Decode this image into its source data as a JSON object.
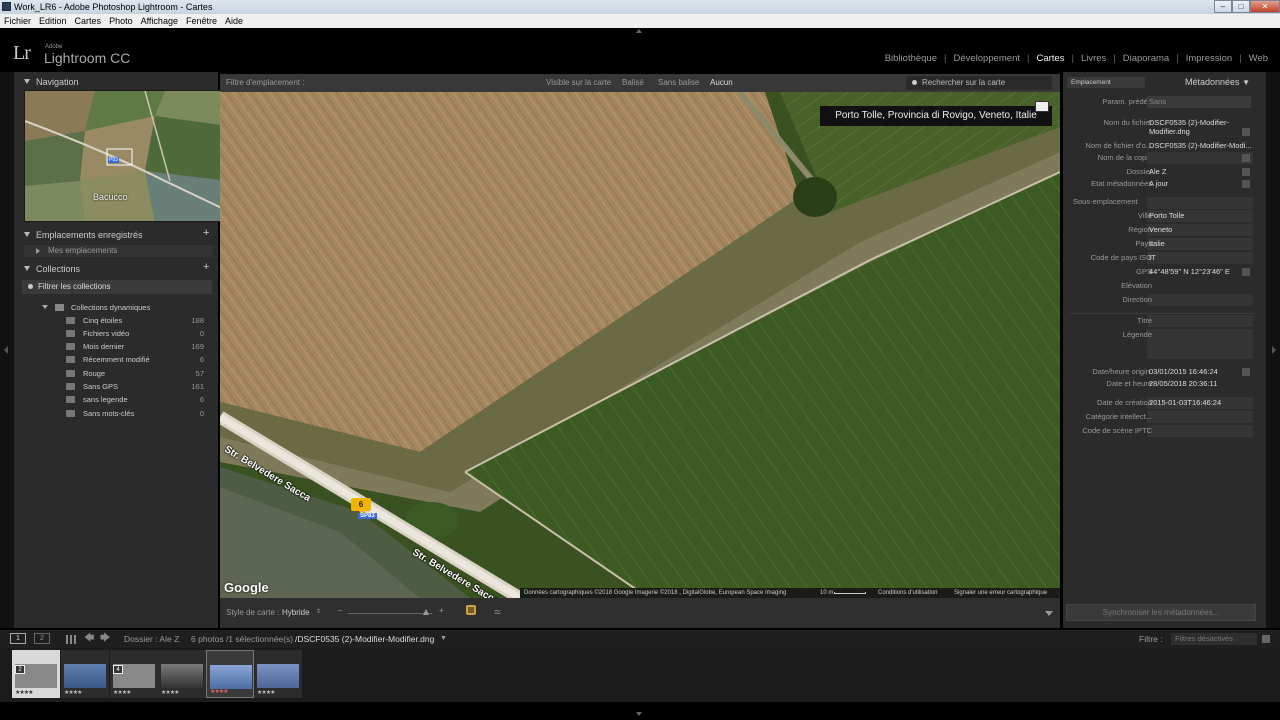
{
  "window": {
    "title": "Work_LR6 - Adobe Photoshop Lightroom - Cartes"
  },
  "menu": [
    "Fichier",
    "Edition",
    "Cartes",
    "Photo",
    "Affichage",
    "Fenêtre",
    "Aide"
  ],
  "brand": {
    "adobe": "Adobe",
    "name": "Lightroom CC",
    "logo": "Lr"
  },
  "modules": [
    "Bibliothèque",
    "Développement",
    "Cartes",
    "Livres",
    "Diaporama",
    "Impression",
    "Web"
  ],
  "active_module": "Cartes",
  "left": {
    "navigation": "Navigation",
    "nav_map_label": "Bacucco",
    "nav_pin": "P83",
    "saved_locations": "Emplacements enregistrés",
    "my_locations": "Mes emplacements",
    "collections": "Collections",
    "filter": "Filtrer les collections",
    "smart_collections": "Collections dynamiques",
    "items": [
      {
        "name": "Cinq étoiles",
        "count": "188"
      },
      {
        "name": "Fichiers vidéo",
        "count": "0"
      },
      {
        "name": "Mois dernier",
        "count": "169"
      },
      {
        "name": "Récemment modifié",
        "count": "6"
      },
      {
        "name": "Rouge",
        "count": "57"
      },
      {
        "name": "Sans GPS",
        "count": "161"
      },
      {
        "name": "sans legende",
        "count": "6"
      },
      {
        "name": "Sans mots-clés",
        "count": "0"
      }
    ]
  },
  "map_toolbar": {
    "label": "Filtre d'emplacement :",
    "filters": [
      "Visible sur la carte",
      "Balisé",
      "Sans balise",
      "Aucun"
    ],
    "active_filter": "Aucun",
    "search_placeholder": "Rechercher sur la carte"
  },
  "map": {
    "location": "Porto Tolle, Provincia di Rovigo, Veneto, Italie",
    "road1": "Str. Belvedere Sacca",
    "road2": "Str. Belvedere Sacca",
    "marker_count": "6",
    "road_badge": "SP83",
    "google": "Google",
    "attribution": "Données cartographiques ©2018 Google Imagerie ©2018 , DigitalGlobe, European Space Imaging",
    "scale": "10 m",
    "terms": "Conditions d'utilisation",
    "report": "Signaler une erreur cartographique"
  },
  "map_bottom": {
    "style_label": "Style de carte :",
    "style_value": "Hybride"
  },
  "right": {
    "preset_dropdown": "Emplacement",
    "title": "Métadonnées",
    "preset_label": "Param. prédéf.",
    "preset_value": "Sans",
    "fields": [
      {
        "label": "Nom du fichier",
        "value": "DSCF0535 (2)-Modifier-"
      },
      {
        "label": "",
        "value": "Modifier.dng"
      },
      {
        "label": "Nom de fichier d'o...",
        "value": "DSCF0535 (2)-Modifier-Modi..."
      },
      {
        "label": "Nom de la copie",
        "value": ""
      },
      {
        "label": "Dossier",
        "value": "Ale Z"
      },
      {
        "label": "Etat métadonnées",
        "value": "A jour"
      }
    ],
    "sublocation": "Sous-emplacement",
    "loc_fields": [
      {
        "label": "Ville",
        "value": "Porto Tolle"
      },
      {
        "label": "Région",
        "value": "Veneto"
      },
      {
        "label": "Pays",
        "value": "Italie"
      },
      {
        "label": "Code de pays ISO",
        "value": "IT"
      },
      {
        "label": "GPS",
        "value": "44°48'59\" N 12°23'46\" E"
      },
      {
        "label": "Elévation",
        "value": ""
      },
      {
        "label": "Direction",
        "value": ""
      }
    ],
    "title_label": "Titre",
    "caption_label": "Légende",
    "date_fields": [
      {
        "label": "Date/heure origin.",
        "value": "03/01/2015 16:46:24"
      },
      {
        "label": "Date et heure",
        "value": "28/05/2018 20:36:11"
      }
    ],
    "creation_label": "Date de création",
    "creation_value": "2015-01-03T16:46:24",
    "category_label": "Catégorie intellect...",
    "iptc_label": "Code de scène IPTC",
    "sync_button": "Synchroniser les métadonnées..."
  },
  "filmstrip": {
    "folder": "Dossier : Ale Z",
    "count": "6 photos /1 sélectionnée(s)",
    "path": "/DSCF0535 (2)-Modifier-Modifier.dng",
    "filter_label": "Filtre :",
    "filter_value": "Filtres désactivés",
    "pages": [
      "1",
      "2"
    ],
    "thumbs": [
      {
        "stack": "2",
        "stars": "★★★★",
        "color": "#8a8a8a"
      },
      {
        "stack": "",
        "stars": "★★★★",
        "color": "#5f7fae"
      },
      {
        "stack": "4",
        "stars": "★★★★",
        "color": "#888888"
      },
      {
        "stack": "",
        "stars": "★★★★",
        "color": "#555555"
      },
      {
        "stack": "",
        "stars": "★★★★",
        "color": "#6c86b8"
      },
      {
        "stack": "",
        "stars": "★★★★",
        "color": "#5a6f9c"
      }
    ]
  }
}
